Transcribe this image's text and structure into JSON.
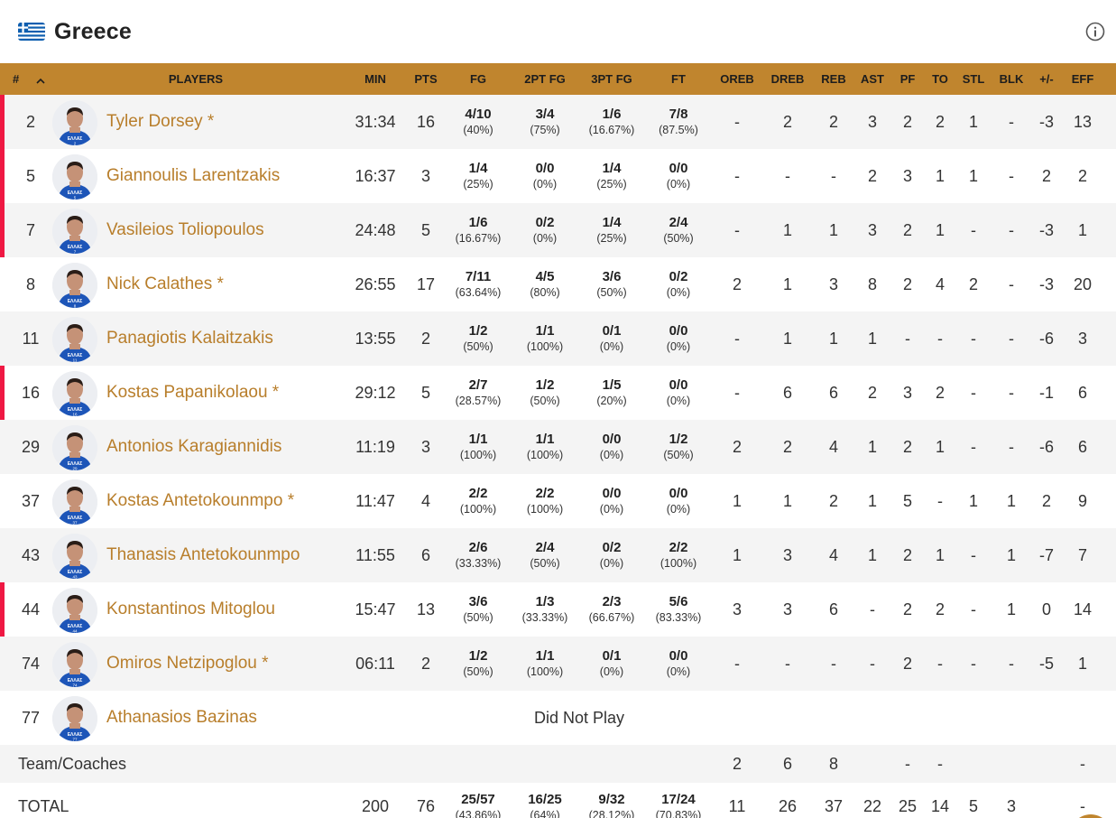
{
  "team": {
    "name": "Greece",
    "flag_icon": "greece-flag-icon",
    "info_icon": "info-icon"
  },
  "colors": {
    "header_bg": "#c0852e",
    "player_name": "#b87e2b",
    "starter_marker": "#ef1843",
    "row_alt": "#f4f4f4"
  },
  "table": {
    "columns": [
      "#",
      "PLAYERS",
      "MIN",
      "PTS",
      "FG",
      "2PT FG",
      "3PT FG",
      "FT",
      "OREB",
      "DREB",
      "REB",
      "AST",
      "PF",
      "TO",
      "STL",
      "BLK",
      "+/-",
      "EFF"
    ],
    "sort_icon": "chevron-up-icon",
    "players": [
      {
        "num": "2",
        "name": "Tyler Dorsey *",
        "marker": true,
        "min": "31:34",
        "pts": "16",
        "fg": [
          "4/10",
          "(40%)"
        ],
        "fg2": [
          "3/4",
          "(75%)"
        ],
        "fg3": [
          "1/6",
          "(16.67%)"
        ],
        "ft": [
          "7/8",
          "(87.5%)"
        ],
        "stats": [
          "-",
          "2",
          "2",
          "3",
          "2",
          "2",
          "1",
          "-",
          "-3",
          "13"
        ]
      },
      {
        "num": "5",
        "name": "Giannoulis Larentzakis",
        "marker": true,
        "min": "16:37",
        "pts": "3",
        "fg": [
          "1/4",
          "(25%)"
        ],
        "fg2": [
          "0/0",
          "(0%)"
        ],
        "fg3": [
          "1/4",
          "(25%)"
        ],
        "ft": [
          "0/0",
          "(0%)"
        ],
        "stats": [
          "-",
          "-",
          "-",
          "2",
          "3",
          "1",
          "1",
          "-",
          "2",
          "2"
        ]
      },
      {
        "num": "7",
        "name": "Vasileios Toliopoulos",
        "marker": true,
        "min": "24:48",
        "pts": "5",
        "fg": [
          "1/6",
          "(16.67%)"
        ],
        "fg2": [
          "0/2",
          "(0%)"
        ],
        "fg3": [
          "1/4",
          "(25%)"
        ],
        "ft": [
          "2/4",
          "(50%)"
        ],
        "stats": [
          "-",
          "1",
          "1",
          "3",
          "2",
          "1",
          "-",
          "-",
          "-3",
          "1"
        ]
      },
      {
        "num": "8",
        "name": "Nick Calathes *",
        "marker": false,
        "min": "26:55",
        "pts": "17",
        "fg": [
          "7/11",
          "(63.64%)"
        ],
        "fg2": [
          "4/5",
          "(80%)"
        ],
        "fg3": [
          "3/6",
          "(50%)"
        ],
        "ft": [
          "0/2",
          "(0%)"
        ],
        "stats": [
          "2",
          "1",
          "3",
          "8",
          "2",
          "4",
          "2",
          "-",
          "-3",
          "20"
        ]
      },
      {
        "num": "11",
        "name": "Panagiotis Kalaitzakis",
        "marker": false,
        "min": "13:55",
        "pts": "2",
        "fg": [
          "1/2",
          "(50%)"
        ],
        "fg2": [
          "1/1",
          "(100%)"
        ],
        "fg3": [
          "0/1",
          "(0%)"
        ],
        "ft": [
          "0/0",
          "(0%)"
        ],
        "stats": [
          "-",
          "1",
          "1",
          "1",
          "-",
          "-",
          "-",
          "-",
          "-6",
          "3"
        ]
      },
      {
        "num": "16",
        "name": "Kostas Papanikolaou *",
        "marker": true,
        "min": "29:12",
        "pts": "5",
        "fg": [
          "2/7",
          "(28.57%)"
        ],
        "fg2": [
          "1/2",
          "(50%)"
        ],
        "fg3": [
          "1/5",
          "(20%)"
        ],
        "ft": [
          "0/0",
          "(0%)"
        ],
        "stats": [
          "-",
          "6",
          "6",
          "2",
          "3",
          "2",
          "-",
          "-",
          "-1",
          "6"
        ]
      },
      {
        "num": "29",
        "name": "Antonios Karagiannidis",
        "marker": false,
        "min": "11:19",
        "pts": "3",
        "fg": [
          "1/1",
          "(100%)"
        ],
        "fg2": [
          "1/1",
          "(100%)"
        ],
        "fg3": [
          "0/0",
          "(0%)"
        ],
        "ft": [
          "1/2",
          "(50%)"
        ],
        "stats": [
          "2",
          "2",
          "4",
          "1",
          "2",
          "1",
          "-",
          "-",
          "-6",
          "6"
        ]
      },
      {
        "num": "37",
        "name": "Kostas Antetokounmpo *",
        "marker": false,
        "min": "11:47",
        "pts": "4",
        "fg": [
          "2/2",
          "(100%)"
        ],
        "fg2": [
          "2/2",
          "(100%)"
        ],
        "fg3": [
          "0/0",
          "(0%)"
        ],
        "ft": [
          "0/0",
          "(0%)"
        ],
        "stats": [
          "1",
          "1",
          "2",
          "1",
          "5",
          "-",
          "1",
          "1",
          "2",
          "9"
        ]
      },
      {
        "num": "43",
        "name": "Thanasis Antetokounmpo",
        "marker": false,
        "min": "11:55",
        "pts": "6",
        "fg": [
          "2/6",
          "(33.33%)"
        ],
        "fg2": [
          "2/4",
          "(50%)"
        ],
        "fg3": [
          "0/2",
          "(0%)"
        ],
        "ft": [
          "2/2",
          "(100%)"
        ],
        "stats": [
          "1",
          "3",
          "4",
          "1",
          "2",
          "1",
          "-",
          "1",
          "-7",
          "7"
        ]
      },
      {
        "num": "44",
        "name": "Konstantinos Mitoglou",
        "marker": true,
        "min": "15:47",
        "pts": "13",
        "fg": [
          "3/6",
          "(50%)"
        ],
        "fg2": [
          "1/3",
          "(33.33%)"
        ],
        "fg3": [
          "2/3",
          "(66.67%)"
        ],
        "ft": [
          "5/6",
          "(83.33%)"
        ],
        "stats": [
          "3",
          "3",
          "6",
          "-",
          "2",
          "2",
          "-",
          "1",
          "0",
          "14"
        ]
      },
      {
        "num": "74",
        "name": "Omiros Netzipoglou *",
        "marker": false,
        "min": "06:11",
        "pts": "2",
        "fg": [
          "1/2",
          "(50%)"
        ],
        "fg2": [
          "1/1",
          "(100%)"
        ],
        "fg3": [
          "0/1",
          "(0%)"
        ],
        "ft": [
          "0/0",
          "(0%)"
        ],
        "stats": [
          "-",
          "-",
          "-",
          "-",
          "2",
          "-",
          "-",
          "-",
          "-5",
          "1"
        ]
      },
      {
        "num": "77",
        "name": "Athanasios Bazinas",
        "marker": false,
        "dnp": "Did Not Play"
      }
    ],
    "team_coaches": {
      "label": "Team/Coaches",
      "stats": [
        "2",
        "6",
        "8",
        "",
        "-",
        "-",
        "",
        "",
        "",
        "-"
      ]
    },
    "total": {
      "label": "TOTAL",
      "min": "200",
      "pts": "76",
      "fg": [
        "25/57",
        "(43.86%)"
      ],
      "fg2": [
        "16/25",
        "(64%)"
      ],
      "fg3": [
        "9/32",
        "(28.12%)"
      ],
      "ft": [
        "17/24",
        "(70.83%)"
      ],
      "stats": [
        "11",
        "26",
        "37",
        "22",
        "25",
        "14",
        "5",
        "3",
        "",
        "-"
      ]
    }
  }
}
